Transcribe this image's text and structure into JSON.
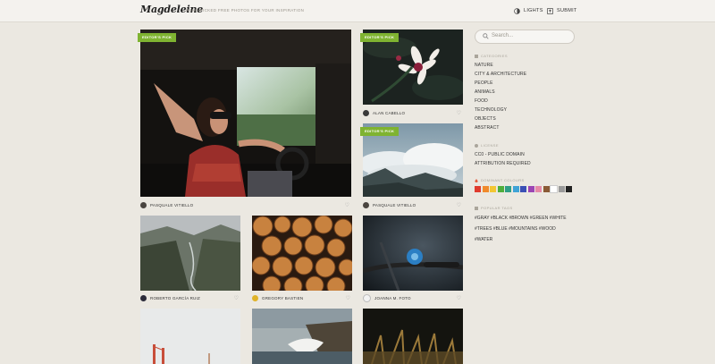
{
  "header": {
    "logo": "Magdeleine",
    "tagline": "HAND-PICKED FREE PHOTOS FOR YOUR INSPIRATION",
    "lights_label": "LIGHTS",
    "submit_label": "SUBMIT"
  },
  "cards": [
    {
      "author": "PASQUALE VITIELLO",
      "badge": "EDITOR'S PICK"
    },
    {
      "author": "ALAN CABELLO",
      "badge": "EDITOR'S PICK"
    },
    {
      "author": "PASQUALE VITIELLO",
      "badge": "EDITOR'S PICK"
    },
    {
      "author": "ROBERTO GARCÍA RUIZ"
    },
    {
      "author": "GREGORY BASTIEN"
    },
    {
      "author": "JOANNA M. FOTO"
    }
  ],
  "sidebar": {
    "search_placeholder": "Search...",
    "categories_title": "CATEGORIES",
    "categories": [
      "NATURE",
      "CITY & ARCHITECTURE",
      "PEOPLE",
      "ANIMALS",
      "FOOD",
      "TECHNOLOGY",
      "OBJECTS",
      "ABSTRACT"
    ],
    "license_title": "LICENSE",
    "licenses": [
      "CC0 - PUBLIC DOMAIN",
      "ATTRIBUTION REQUIRED"
    ],
    "colours_title": "DOMINANT COLOURS",
    "colours": [
      "#e03b2e",
      "#f08a2c",
      "#f3c632",
      "#4fae3c",
      "#2f9e86",
      "#3fa3d6",
      "#3a4fb5",
      "#9b45b4",
      "#e58aa8",
      "#8a5a35",
      "#ffffff",
      "#9a9a9a",
      "#222222"
    ],
    "tags_title": "POPULAR TAGS",
    "tags_line1": "#GRAY #BLACK #BROWN #GREEN #WHITE",
    "tags_line2": "#TREES #BLUE #MOUNTAINS #WOOD",
    "tags_line3": "#WATER"
  }
}
